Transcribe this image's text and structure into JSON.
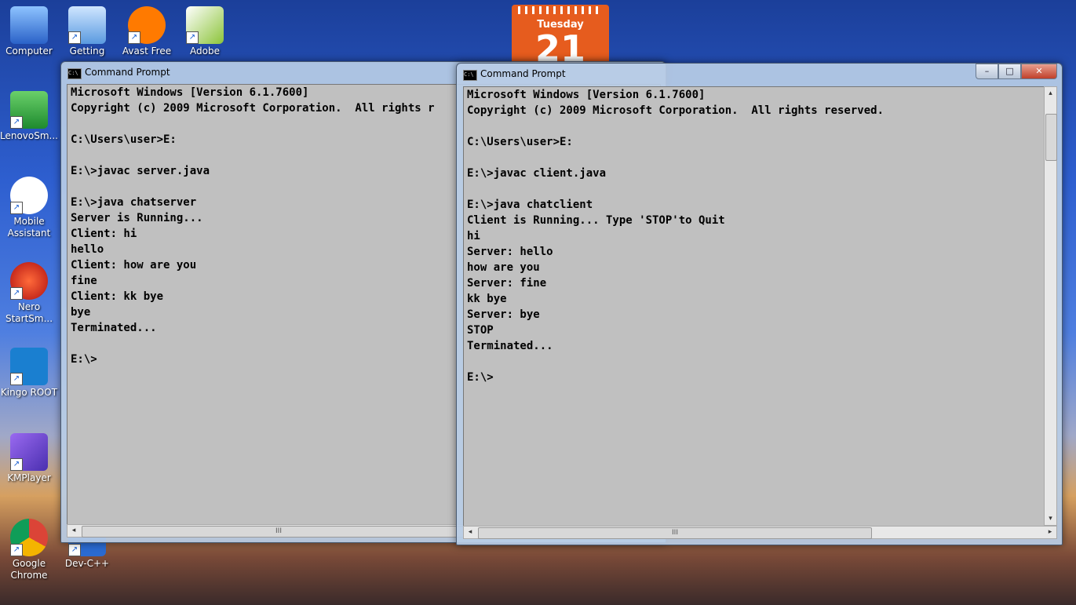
{
  "desktop": {
    "icons": [
      {
        "label": "Computer",
        "icon": "computer-icon",
        "color": "#3a7bd5"
      },
      {
        "label": "Getting",
        "icon": "getting-started-icon",
        "color": "#7ab0e8"
      },
      {
        "label": "Avast Free",
        "icon": "avast-icon",
        "color": "#ff7a00"
      },
      {
        "label": "Adobe",
        "icon": "adobe-icon",
        "color": "#f0f0f0"
      },
      {
        "label": "LenovoSm...",
        "icon": "lenovo-icon",
        "color": "#2e9e3a"
      },
      {
        "label": "Mobile Assistant",
        "icon": "mobile-assistant-icon",
        "color": "#ffffff"
      },
      {
        "label": "Nero StartSm...",
        "icon": "nero-icon",
        "color": "#d82020"
      },
      {
        "label": "Kingo ROOT",
        "icon": "kingo-root-icon",
        "color": "#1a7fd0"
      },
      {
        "label": "KMPlayer",
        "icon": "kmplayer-icon",
        "color": "#6a3fd0"
      },
      {
        "label": "Google Chrome",
        "icon": "chrome-icon",
        "color": "#db4437"
      },
      {
        "label": "Dev-C++",
        "icon": "devcpp-icon",
        "color": "#2a6ad0"
      }
    ],
    "calendar": {
      "day": "Tuesday",
      "date": "21"
    }
  },
  "server_window": {
    "title": "Command Prompt",
    "output": "Microsoft Windows [Version 6.1.7600]\nCopyright (c) 2009 Microsoft Corporation.  All rights r\n\nC:\\Users\\user>E:\n\nE:\\>javac server.java\n\nE:\\>java chatserver\nServer is Running...\nClient: hi\nhello\nClient: how are you\nfine\nClient: kk bye\nbye\nTerminated...\n\nE:\\>",
    "scroll_grip": "III"
  },
  "client_window": {
    "title": "Command Prompt",
    "output": "Microsoft Windows [Version 6.1.7600]\nCopyright (c) 2009 Microsoft Corporation.  All rights reserved.\n\nC:\\Users\\user>E:\n\nE:\\>javac client.java\n\nE:\\>java chatclient\nClient is Running... Type 'STOP'to Quit\nhi\nServer: hello\nhow are you\nServer: fine\nkk bye\nServer: bye\nSTOP\nTerminated...\n\nE:\\>",
    "scroll_grip": "III",
    "controls": {
      "minimize": "–",
      "maximize": "□",
      "close": "✕"
    }
  },
  "scroll_arrows": {
    "left": "◂",
    "right": "▸",
    "up": "▴",
    "down": "▾"
  }
}
